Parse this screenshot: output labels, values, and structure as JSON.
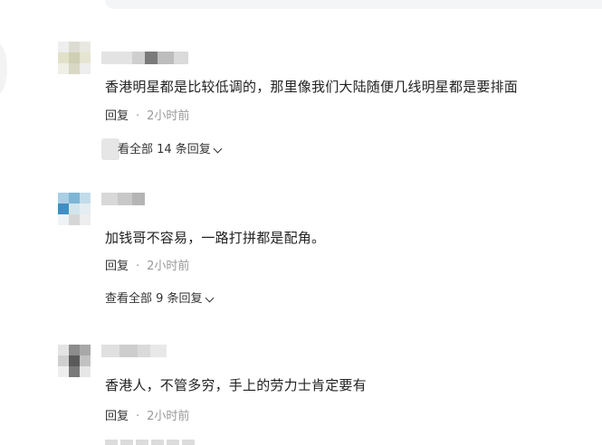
{
  "comments": [
    {
      "text": "香港明星都是比较低调的，那里像我们大陆随便几线明星都是要排面",
      "reply_label": "回复",
      "separator": "·",
      "time": "2小时前",
      "view_replies": "查看全部 14 条回复"
    },
    {
      "text": "加钱哥不容易，一路打拼都是配角。",
      "reply_label": "回复",
      "separator": "·",
      "time": "2小时前",
      "view_replies": "查看全部 9 条回复"
    },
    {
      "text": "香港人，不管多穷，手上的劳力士肯定要有",
      "reply_label": "回复",
      "separator": "·",
      "time": "2小时前"
    }
  ],
  "view_replies_partial": "看全部 14 条回复",
  "icons": {
    "chevron": "chevron-down-icon"
  },
  "colors": {
    "text": "#222222",
    "meta": "#999999",
    "action": "#333333"
  }
}
